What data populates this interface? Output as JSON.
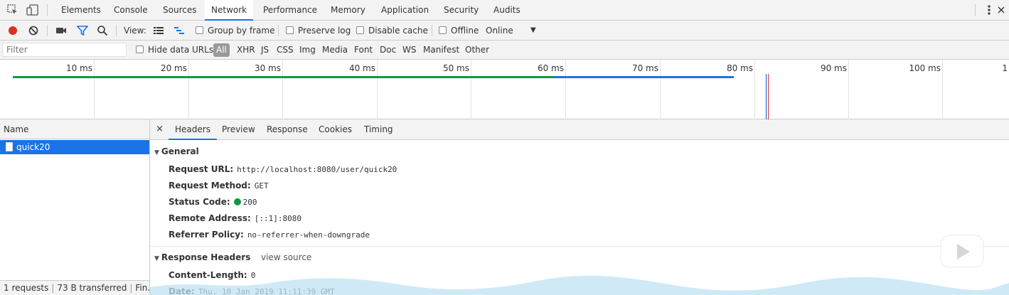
{
  "tabs": [
    {
      "label": "Elements"
    },
    {
      "label": "Console"
    },
    {
      "label": "Sources"
    },
    {
      "label": "Network",
      "active": true
    },
    {
      "label": "Performance"
    },
    {
      "label": "Memory"
    },
    {
      "label": "Application"
    },
    {
      "label": "Security"
    },
    {
      "label": "Audits"
    }
  ],
  "toolbar": {
    "view_label": "View:",
    "group_by_frame": "Group by frame",
    "preserve_log": "Preserve log",
    "disable_cache": "Disable cache",
    "offline": "Offline",
    "throttle": "Online",
    "record_color": "#d93025",
    "filter_color": "#1a73e8"
  },
  "filter": {
    "placeholder": "Filter",
    "hide_data_urls": "Hide data URLs",
    "all": "All",
    "types": [
      "XHR",
      "JS",
      "CSS",
      "Img",
      "Media",
      "Font",
      "Doc",
      "WS",
      "Manifest",
      "Other"
    ]
  },
  "overview": {
    "ticks": [
      "10 ms",
      "20 ms",
      "30 ms",
      "40 ms",
      "50 ms",
      "60 ms",
      "70 ms",
      "80 ms",
      "90 ms",
      "100 ms",
      "1"
    ],
    "bar_colors": [
      "#0a9c3c",
      "#1a73e8"
    ],
    "line_colors": [
      "#1a4fd6",
      "#d93025"
    ]
  },
  "names": {
    "header": "Name",
    "rows": [
      "quick20"
    ],
    "status": {
      "requests": "1 requests",
      "transferred": "73 B transferred",
      "finish": "Fin..."
    }
  },
  "detail": {
    "close": "×",
    "tabs": [
      {
        "label": "Headers",
        "active": true
      },
      {
        "label": "Preview"
      },
      {
        "label": "Response"
      },
      {
        "label": "Cookies"
      },
      {
        "label": "Timing"
      }
    ],
    "general": {
      "title": "General",
      "rows": [
        {
          "key": "Request URL:",
          "value": "http://localhost:8080/user/quick20"
        },
        {
          "key": "Request Method:",
          "value": "GET"
        },
        {
          "key": "Status Code:",
          "value": "200",
          "status_color": "#0a9c3c"
        },
        {
          "key": "Remote Address:",
          "value": "[::1]:8080"
        },
        {
          "key": "Referrer Policy:",
          "value": "no-referrer-when-downgrade"
        }
      ]
    },
    "response_headers": {
      "title": "Response Headers",
      "view_source": "view source",
      "rows": [
        {
          "key": "Content-Length:",
          "value": "0"
        },
        {
          "key": "Date:",
          "value": "Thu, 10 Jan 2019 11:11:39 GMT"
        }
      ]
    }
  }
}
